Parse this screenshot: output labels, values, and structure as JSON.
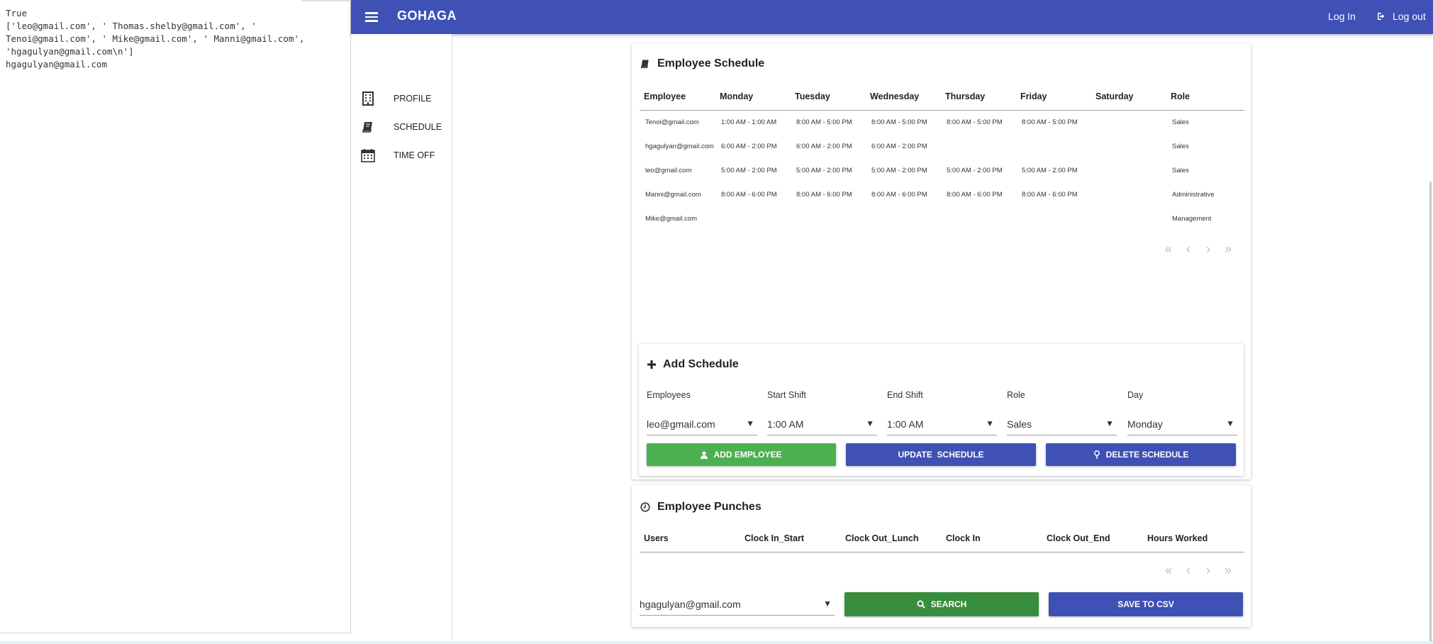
{
  "console": {
    "output": "True\n['leo@gmail.com', ' Thomas.shelby@gmail.com', '\nTenoi@gmail.com', ' Mike@gmail.com', ' Manni@gmail.com',\n'hgagulyan@gmail.com\\n']\nhgagulyan@gmail.com"
  },
  "appbar": {
    "brand": "GOHAGA",
    "login_label": "Log In",
    "logout_label": "Log out"
  },
  "sidenav": {
    "items": [
      {
        "label": "PROFILE",
        "icon": "building-icon"
      },
      {
        "label": "SCHEDULE",
        "icon": "book-icon"
      },
      {
        "label": "TIME OFF",
        "icon": "calendar-icon"
      }
    ]
  },
  "schedule": {
    "title": "Employee Schedule",
    "columns": [
      "Employee",
      "Monday",
      "Tuesday",
      "Wednesday",
      "Thursday",
      "Friday",
      "Saturday",
      "Role"
    ],
    "rows": [
      [
        "Tenoi@gmail.com",
        "1:00 AM - 1:00 AM",
        "8:00 AM - 5:00 PM",
        "8:00 AM - 5:00 PM",
        "8:00 AM - 5:00 PM",
        "8:00 AM - 5:00 PM",
        "",
        "Sales"
      ],
      [
        "hgagulyan@gmail.com",
        "6:00 AM - 2:00 PM",
        "6:00 AM - 2:00 PM",
        "6:00 AM - 2:00 PM",
        "",
        "",
        "",
        "Sales"
      ],
      [
        "leo@gmail.com",
        "5:00 AM - 2:00 PM",
        "5:00 AM - 2:00 PM",
        "5:00 AM - 2:00 PM",
        "5:00 AM - 2:00 PM",
        "5:00 AM - 2:00 PM",
        "",
        "Sales"
      ],
      [
        "Manni@gmail.com",
        "8:00 AM - 6:00 PM",
        "8:00 AM - 6:00 PM",
        "8:00 AM - 6:00 PM",
        "8:00 AM - 6:00 PM",
        "8:00 AM - 6:00 PM",
        "",
        "Administrative"
      ],
      [
        "Mike@gmail.com",
        "",
        "",
        "",
        "",
        "",
        "",
        "Management"
      ]
    ]
  },
  "add_schedule": {
    "title": "Add Schedule",
    "fields": [
      {
        "label": "Employees",
        "value": "leo@gmail.com"
      },
      {
        "label": "Start Shift",
        "value": "1:00 AM"
      },
      {
        "label": "End Shift",
        "value": "1:00 AM"
      },
      {
        "label": "Role",
        "value": "Sales"
      },
      {
        "label": "Day",
        "value": "Monday"
      }
    ],
    "add_button": "ADD EMPLOYEE",
    "update_button": "UPDATE  SCHEDULE",
    "delete_button": "DELETE SCHEDULE"
  },
  "punches": {
    "title": "Employee Punches",
    "columns": [
      "Users",
      "Clock In_Start",
      "Clock Out_Lunch",
      "Clock In",
      "Clock Out_End",
      "Hours Worked"
    ],
    "user_select": "hgagulyan@gmail.com",
    "search_button": "SEARCH",
    "save_button": "SAVE TO CSV"
  },
  "colors": {
    "primary": "#3f51b5",
    "green": "#4caf50",
    "dark_green": "#388e3c"
  }
}
